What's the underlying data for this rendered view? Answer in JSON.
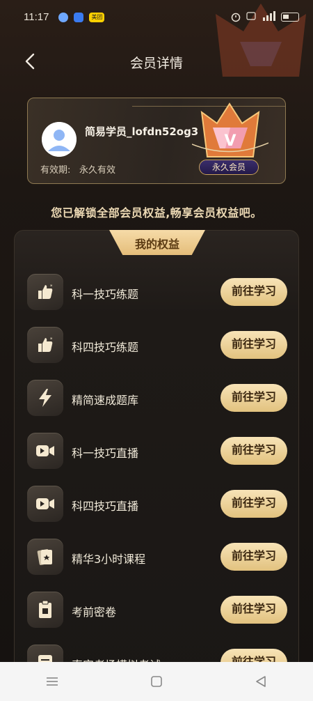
{
  "status_bar": {
    "time": "11:17",
    "right_icons": [
      "alarm-icon",
      "hd-icon",
      "signal-icon",
      "wifi-icon",
      "battery-icon"
    ],
    "app_badge_text": "美团"
  },
  "header": {
    "title": "会员详情"
  },
  "member_card": {
    "username": "简易学员_lofdn52og3",
    "validity_label": "有效期:",
    "validity_value": "永久有效",
    "badge_label": "永久会员",
    "badge_letter": "V"
  },
  "unlock_message": "您已解锁全部会员权益,畅享会员权益吧。",
  "benefits": {
    "title": "我的权益",
    "button_label": "前往学习",
    "items": [
      {
        "label": "科一技巧练题",
        "icon": "thumbs-up-star-icon"
      },
      {
        "label": "科四技巧练题",
        "icon": "thumbs-up-star-icon"
      },
      {
        "label": "精简速成题库",
        "icon": "lightning-icon"
      },
      {
        "label": "科一技巧直播",
        "icon": "video-camera-icon"
      },
      {
        "label": "科四技巧直播",
        "icon": "video-camera-icon"
      },
      {
        "label": "精华3小时课程",
        "icon": "course-cards-icon"
      },
      {
        "label": "考前密卷",
        "icon": "secret-paper-icon"
      },
      {
        "label": "真实考场模拟考试",
        "icon": "exam-sheet-icon"
      }
    ]
  },
  "nav_bar": {
    "items": [
      "menu-icon",
      "home-square-icon",
      "back-triangle-icon"
    ]
  },
  "colors": {
    "accent_gold": "#e2c27f",
    "background": "#1a1512",
    "badge_purple": "#3a2d6b"
  }
}
